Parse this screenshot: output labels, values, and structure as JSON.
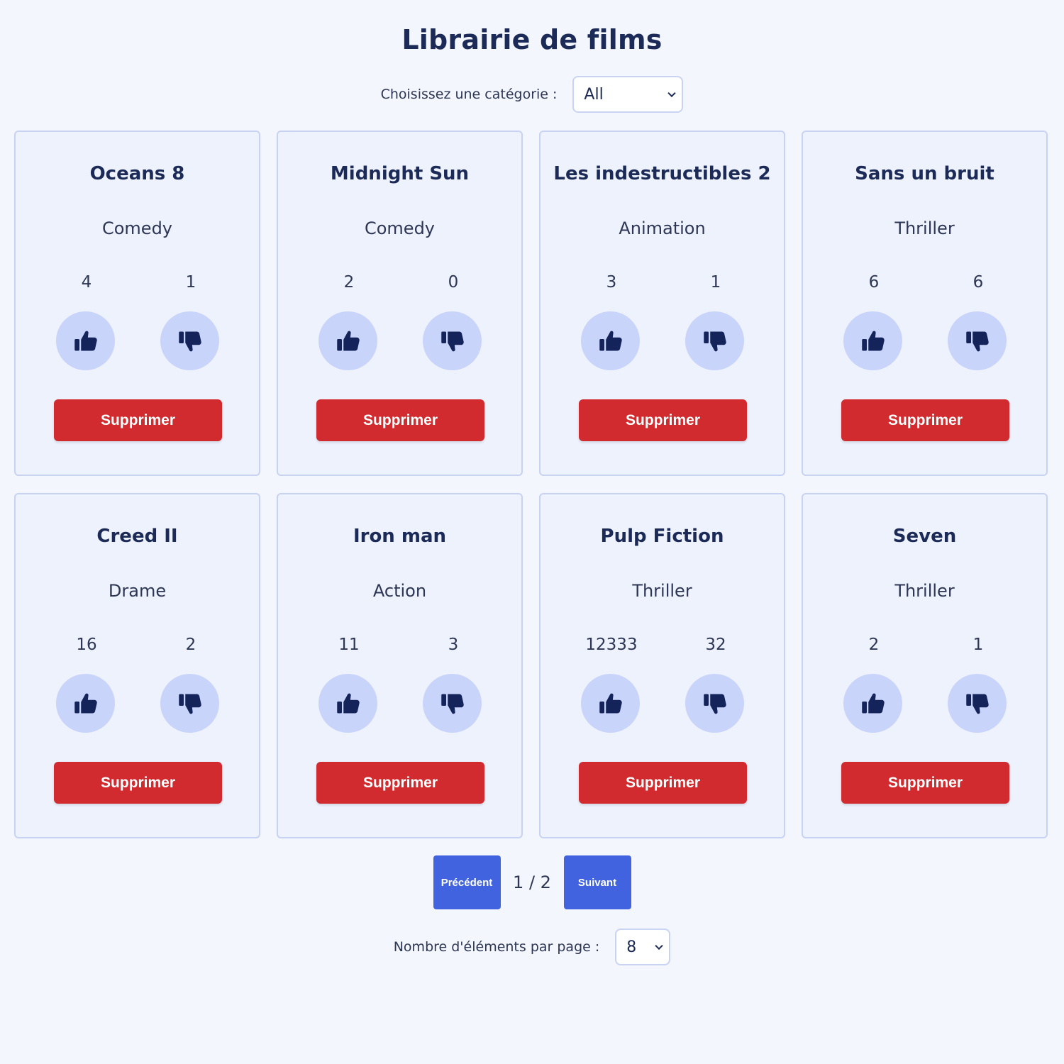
{
  "header": {
    "title": "Librairie de films"
  },
  "filter": {
    "label": "Choisissez une catégorie :",
    "selected": "All"
  },
  "movies": [
    {
      "title": "Oceans 8",
      "category": "Comedy",
      "likes": "4",
      "dislikes": "1",
      "delete_label": "Supprimer"
    },
    {
      "title": "Midnight Sun",
      "category": "Comedy",
      "likes": "2",
      "dislikes": "0",
      "delete_label": "Supprimer"
    },
    {
      "title": "Les indestructibles 2",
      "category": "Animation",
      "likes": "3",
      "dislikes": "1",
      "delete_label": "Supprimer"
    },
    {
      "title": "Sans un bruit",
      "category": "Thriller",
      "likes": "6",
      "dislikes": "6",
      "delete_label": "Supprimer"
    },
    {
      "title": "Creed II",
      "category": "Drame",
      "likes": "16",
      "dislikes": "2",
      "delete_label": "Supprimer"
    },
    {
      "title": "Iron man",
      "category": "Action",
      "likes": "11",
      "dislikes": "3",
      "delete_label": "Supprimer"
    },
    {
      "title": "Pulp Fiction",
      "category": "Thriller",
      "likes": "12333",
      "dislikes": "32",
      "delete_label": "Supprimer"
    },
    {
      "title": "Seven",
      "category": "Thriller",
      "likes": "2",
      "dislikes": "1",
      "delete_label": "Supprimer"
    }
  ],
  "pagination": {
    "prev_label": "Précédent",
    "next_label": "Suivant",
    "indicator": "1 / 2"
  },
  "per_page": {
    "label": "Nombre d'éléments par page :",
    "selected": "8"
  },
  "icons": {
    "like": "thumbs-up-icon",
    "dislike": "thumbs-down-icon",
    "dropdown": "chevron-down-icon"
  },
  "colors": {
    "background": "#f4f6fd",
    "card": "#eef2fd",
    "vote_button": "#c9d4fb",
    "delete": "#d12a2f",
    "pager": "#4163e0",
    "text": "#1c2a57"
  }
}
